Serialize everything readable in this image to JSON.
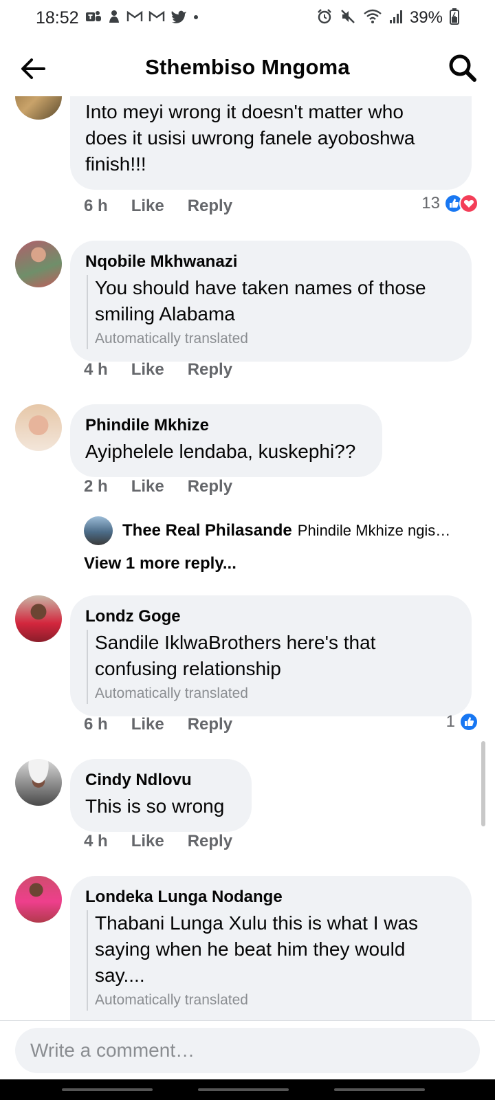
{
  "status_bar": {
    "time": "18:52",
    "battery_percent": "39%"
  },
  "header": {
    "title": "Sthembiso Mngoma"
  },
  "comments": [
    {
      "author": "",
      "text_lines": [
        "Into meyi wrong it doesn't matter who",
        "does it usisi uwrong fanele ayoboshwa",
        "finish!!!"
      ],
      "time": "6 h",
      "like": "Like",
      "reply": "Reply",
      "reactions_count": "13"
    },
    {
      "author": "Nqobile Mkhwanazi",
      "text_lines": [
        "You should have taken names of those",
        "smiling Alabama"
      ],
      "translated": "Automatically translated",
      "time": "4 h",
      "like": "Like",
      "reply": "Reply"
    },
    {
      "author": "Phindile Mkhize",
      "text_lines": [
        "Ayiphelele lendaba, kuskephi??"
      ],
      "time": "2 h",
      "like": "Like",
      "reply": "Reply",
      "reply_preview": {
        "author": "Thee Real Philasande",
        "snippet": "Phindile Mkhize ngis…"
      },
      "view_more": "View 1 more reply..."
    },
    {
      "author": "Londz Goge",
      "text_lines": [
        "Sandile IklwaBrothers here's that",
        "confusing relationship"
      ],
      "translated": "Automatically translated",
      "time": "6 h",
      "like": "Like",
      "reply": "Reply",
      "reactions_count": "1"
    },
    {
      "author": "Cindy Ndlovu",
      "text_lines": [
        "This is so wrong"
      ],
      "time": "4 h",
      "like": "Like",
      "reply": "Reply"
    },
    {
      "author": "Londeka Lunga Nodange",
      "text_lines": [
        "Thabani Lunga Xulu this is what I was",
        "saying when he beat him they would",
        "say...."
      ],
      "translated": "Automatically translated"
    }
  ],
  "composer": {
    "placeholder": "Write a comment…"
  },
  "colors": {
    "like_blue": "#1877f2",
    "love_red": "#f33e58",
    "bubble_gray": "#f0f2f5",
    "meta_gray": "#65676b"
  }
}
